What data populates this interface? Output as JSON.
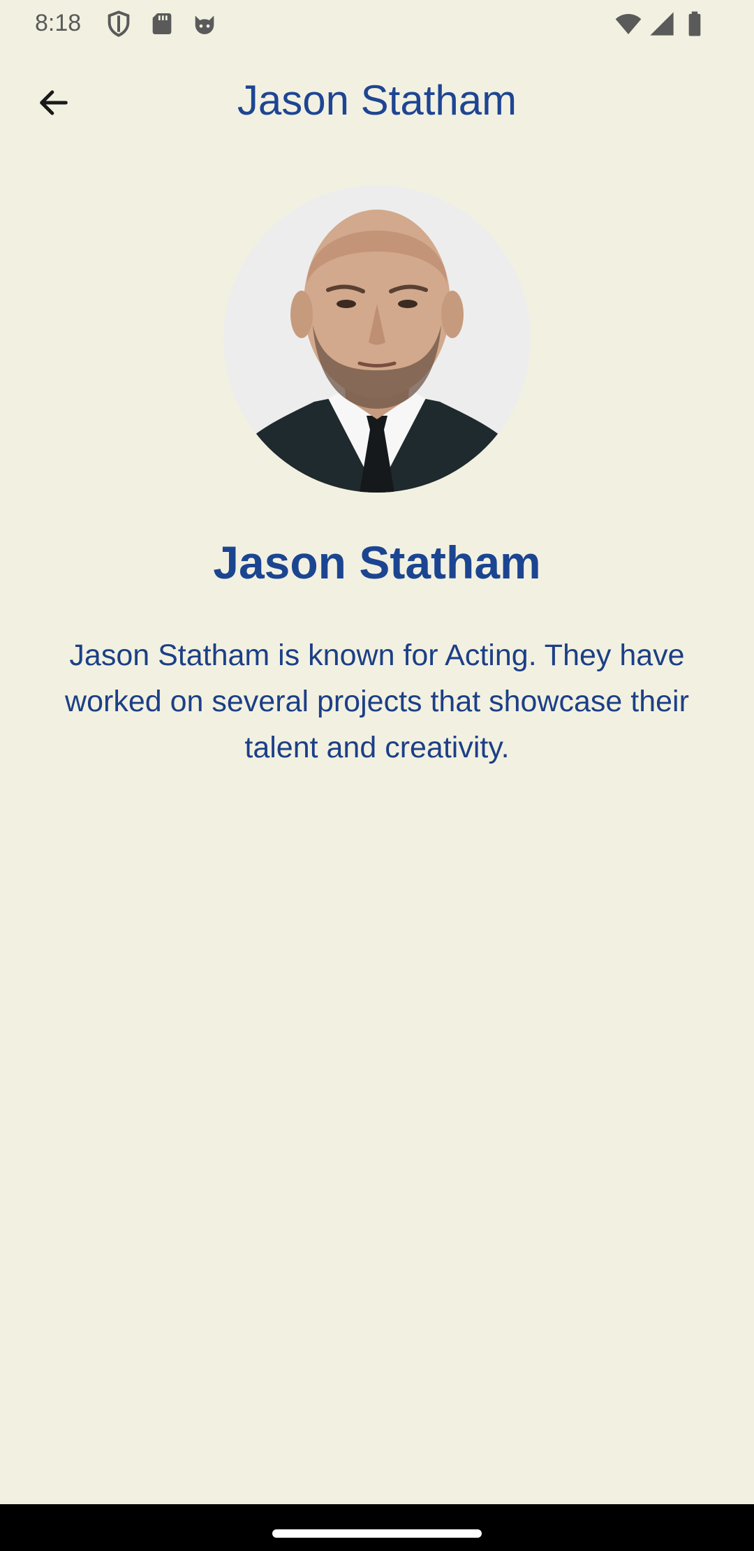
{
  "status_bar": {
    "time": "8:18",
    "left_icons": [
      "shield-icon",
      "sd-card-icon",
      "cat-face-icon"
    ],
    "right_icons": [
      "wifi-icon",
      "cellular-signal-icon",
      "battery-icon"
    ]
  },
  "app_bar": {
    "title": "Jason Statham",
    "back_icon": "arrow-back-icon"
  },
  "profile": {
    "avatar_icon": "person-photo",
    "name": "Jason Statham",
    "bio": "Jason Statham is known for Acting. They have worked on several projects that showcase their talent and creativity."
  },
  "colors": {
    "background": "#f2f1e1",
    "accent": "#1e4594",
    "nav_bar": "#000000"
  }
}
